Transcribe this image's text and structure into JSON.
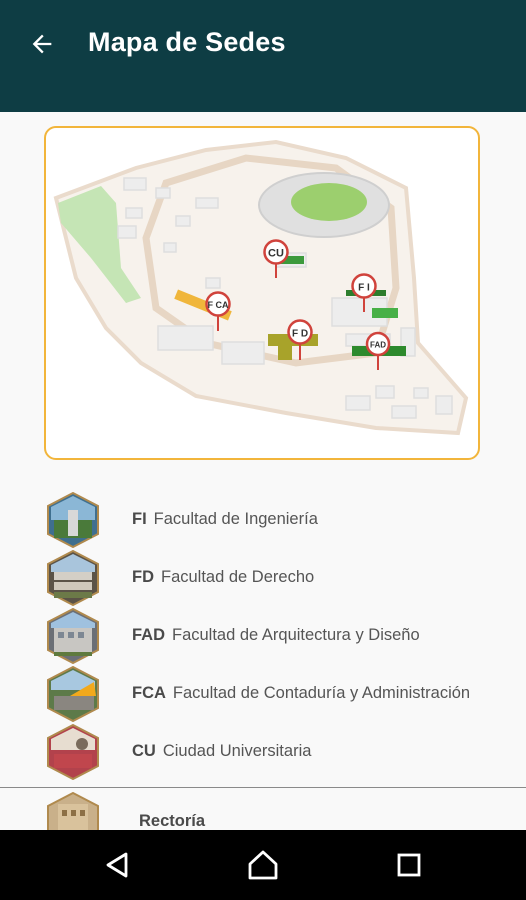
{
  "appbar": {
    "title": "Mapa de Sedes",
    "back_icon": "arrow-back-icon",
    "background": "#0e3d44"
  },
  "map": {
    "border_color": "#f2b53b",
    "markers": [
      {
        "id": "cu",
        "label": "CU"
      },
      {
        "id": "fi",
        "label": "F I"
      },
      {
        "id": "fca",
        "label": "F CA"
      },
      {
        "id": "fd",
        "label": "F D"
      },
      {
        "id": "fad",
        "label": "FAD"
      }
    ]
  },
  "sedes": [
    {
      "code": "FI",
      "name": "Facultad de Ingeniería",
      "thumb": "engineering-building-thumbnail"
    },
    {
      "code": "FD",
      "name": "Facultad de Derecho",
      "thumb": "law-building-thumbnail"
    },
    {
      "code": "FAD",
      "name": "Facultad de Arquitectura y Diseño",
      "thumb": "architecture-building-thumbnail"
    },
    {
      "code": "FCA",
      "name": "Facultad de Contaduría y Administración",
      "thumb": "accounting-building-thumbnail"
    },
    {
      "code": "CU",
      "name": "Ciudad Universitaria",
      "thumb": "campus-thumbnail"
    }
  ],
  "partial_item": {
    "name": "Rectoría",
    "thumb": "rectory-building-thumbnail"
  },
  "navbar": {
    "back": "triangle-back-icon",
    "home": "home-circle-icon",
    "recents": "square-recents-icon"
  }
}
